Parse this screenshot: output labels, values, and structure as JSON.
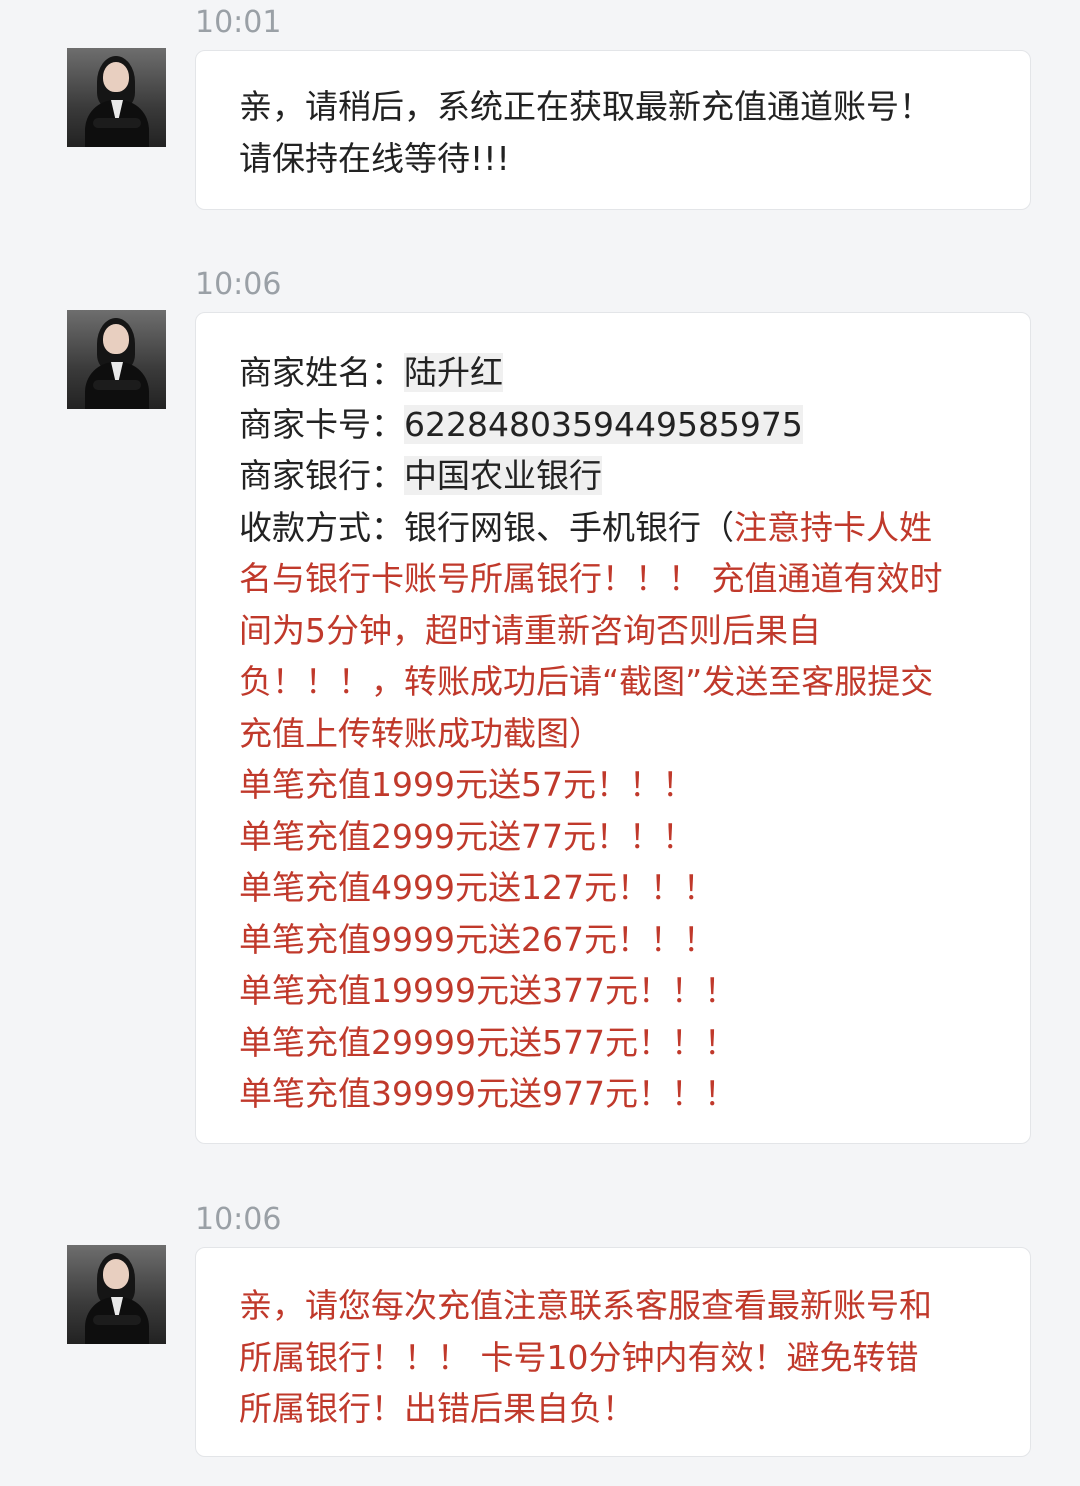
{
  "messages": [
    {
      "time": "10:01",
      "lines": [
        "亲，请稍后，系统正在获取最新充值通道账号！",
        "请保持在线等待!!!"
      ]
    },
    {
      "time": "10:06",
      "fields": [
        {
          "label": "商家姓名：",
          "value": "陆升红"
        },
        {
          "label": "商家卡号：",
          "value": "6228480359449585975"
        },
        {
          "label": "商家银行：",
          "value": "中国农业银行"
        }
      ],
      "payment_label": "收款方式：",
      "payment_value": "银行网银、手机银行（",
      "payment_red_1": "注意持卡人姓",
      "notice_lines": [
        "名与银行卡账号所属银行！！！ 充值通道有效时",
        "间为5分钟，超时请重新咨询否则后果自",
        "负！！！，转账成功后请“截图”发送至客服提交",
        "充值上传转账成功截图）"
      ],
      "bonus_lines": [
        "单笔充值1999元送57元！！！",
        "单笔充值2999元送77元！！！",
        "单笔充值4999元送127元！！！",
        "单笔充值9999元送267元！！！",
        "单笔充值19999元送377元！！！",
        "单笔充值29999元送577元！！！",
        "单笔充值39999元送977元！！！"
      ]
    },
    {
      "time": "10:06",
      "lines": [
        "亲，请您每次充值注意联系客服查看最新账号和",
        "所属银行！！！ 卡号10分钟内有效！避免转错",
        "所属银行！出错后果自负！"
      ]
    }
  ],
  "colors": {
    "background": "#f4f5f7",
    "bubble": "#ffffff",
    "alert_red": "#c0392b",
    "timestamp": "#9aa0a6"
  }
}
